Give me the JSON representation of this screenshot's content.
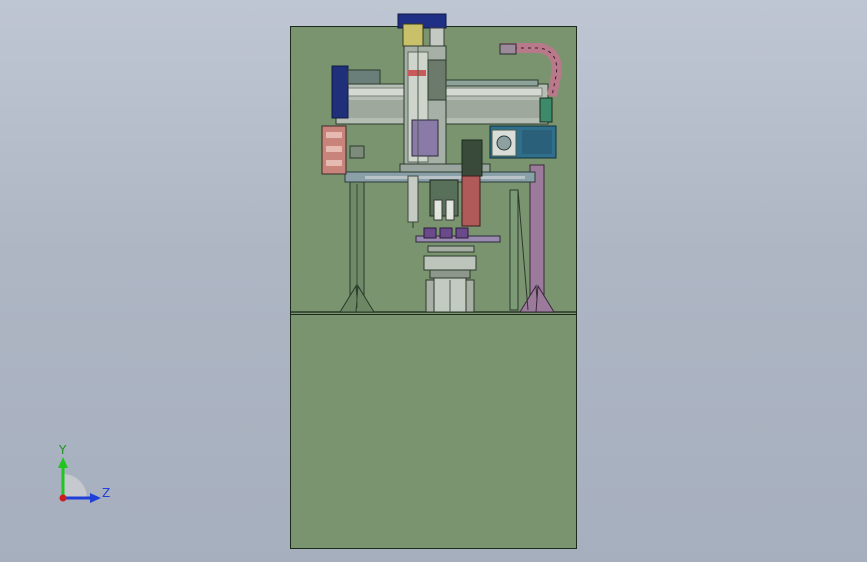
{
  "viewport": {
    "background_top": "#bfc6d3",
    "background_bottom": "#a6afbe"
  },
  "colors": {
    "frame_fill": "#7a9470",
    "frame_edge": "#1b2a1b",
    "axis_x_red": "#d01c1c",
    "axis_y_green": "#22c422",
    "axis_z_blue": "#1f3fd8",
    "triad_label_y": "#1f8f1f",
    "triad_label_z": "#1f3fd8"
  },
  "triad": {
    "y_label": "Y",
    "z_label": "Z"
  },
  "components": [
    "upper-frame-panel",
    "lower-frame-panel",
    "left-column",
    "right-column",
    "gantry-beam",
    "vertical-z-axis",
    "servo-motor",
    "cable-chain",
    "end-effector-grippers",
    "rotary-table",
    "lift-cylinder",
    "control-box-left"
  ]
}
